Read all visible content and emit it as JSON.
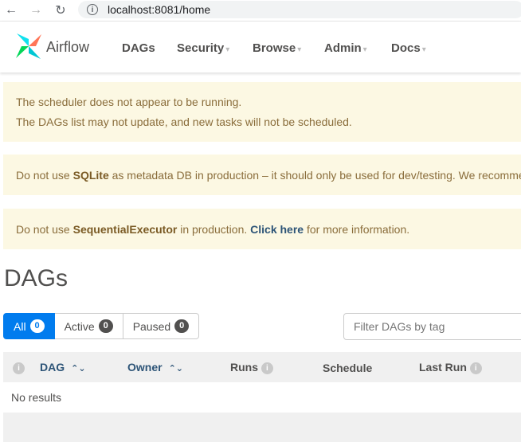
{
  "browser": {
    "url": "localhost:8081/home"
  },
  "navbar": {
    "brand": "Airflow",
    "items": [
      {
        "label": "DAGs",
        "caret": false
      },
      {
        "label": "Security",
        "caret": true
      },
      {
        "label": "Browse",
        "caret": true
      },
      {
        "label": "Admin",
        "caret": true
      },
      {
        "label": "Docs",
        "caret": true
      }
    ]
  },
  "alerts": {
    "scheduler_line1": "The scheduler does not appear to be running.",
    "scheduler_line2": "The DAGs list may not update, and new tasks will not be scheduled.",
    "sqlite_pre": "Do not use ",
    "sqlite_bold": "SQLite",
    "sqlite_post": " as metadata DB in production – it should only be used for dev/testing. We recomme",
    "executor_pre": "Do not use ",
    "executor_bold": "SequentialExecutor",
    "executor_mid": " in production. ",
    "executor_link": "Click here",
    "executor_post": " for more information."
  },
  "page_title": "DAGs",
  "filters": {
    "all": {
      "label": "All",
      "count": "0"
    },
    "active": {
      "label": "Active",
      "count": "0"
    },
    "paused": {
      "label": "Paused",
      "count": "0"
    },
    "tag_placeholder": "Filter DAGs by tag"
  },
  "table": {
    "headers": {
      "dag": "DAG",
      "owner": "Owner",
      "runs": "Runs",
      "schedule": "Schedule",
      "last_run": "Last Run"
    },
    "empty_text": "No results"
  },
  "colors": {
    "accent": "#017cee",
    "alert_bg": "#fcf8e3",
    "alert_text": "#8a6d3b",
    "link": "#2d5477"
  }
}
